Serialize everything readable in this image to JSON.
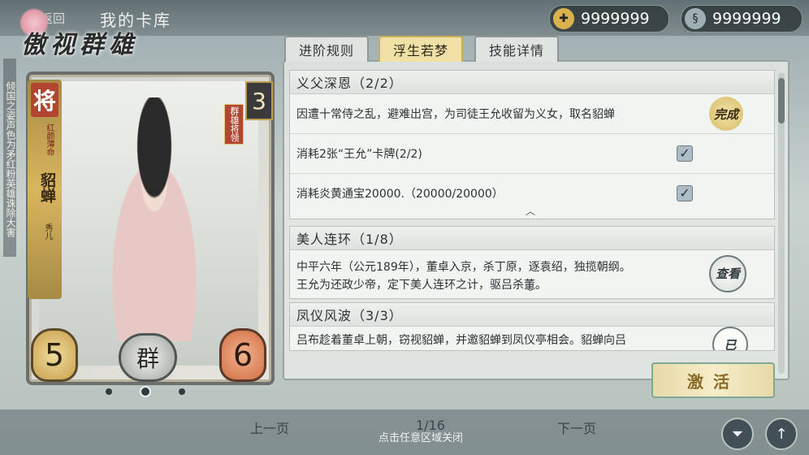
{
  "header": {
    "back_label": "返回",
    "title": "我的卡库",
    "currency_1": {
      "icon": "gold-coin-icon",
      "value": "9999999"
    },
    "currency_2": {
      "icon": "jade-icon",
      "value": "9999999"
    }
  },
  "logo": {
    "text": "傲视群雄"
  },
  "poem_strip": "倾国之姿声色为矛红粉英雄诛除大害",
  "card": {
    "rank_char": "将",
    "title": "红颜薄命",
    "name": "貂蝉",
    "alias": "秀儿",
    "cost": "3",
    "faction_tag": "群雄将领",
    "attack": "5",
    "health": "6",
    "faction": "群",
    "pages_total": 3,
    "active_page": 2
  },
  "tabs": [
    {
      "label": "进阶规则",
      "active": false
    },
    {
      "label": "浮生若梦",
      "active": true
    },
    {
      "label": "技能详情",
      "active": false
    }
  ],
  "sections": [
    {
      "title": "义父深恩（2/2）",
      "rows": [
        {
          "text": "因遭十常侍之乱，避难出宫，为司徒王允收留为义女，取名貂蝉",
          "stamp": "完成"
        },
        {
          "text": "消耗2张“王允”卡牌(2/2)",
          "checked": true
        },
        {
          "text": "消耗炎黄通宝20000.（20000/20000）",
          "checked": true
        }
      ]
    },
    {
      "title": "美人连环（1/8）",
      "text_line1": "中平六年（公元189年），董卓入京，杀丁原，逐袁绍，独揽朝纲。",
      "text_line2": "王允为还政少帝，定下美人连环之计，驱吕杀董。",
      "stamp": "查看"
    },
    {
      "title": "凤仪风波（3/3）",
      "text_line1": "吕布趁着董卓上朝，窃视貂蝉，并邀貂蝉到凤仪亭相会。貂蝉向吕",
      "stamp": "已"
    }
  ],
  "activate_button": "激活",
  "footer": {
    "prev": "上一页",
    "page": "1/16",
    "next": "下一页",
    "close_hint": "点击任意区域关闭"
  }
}
